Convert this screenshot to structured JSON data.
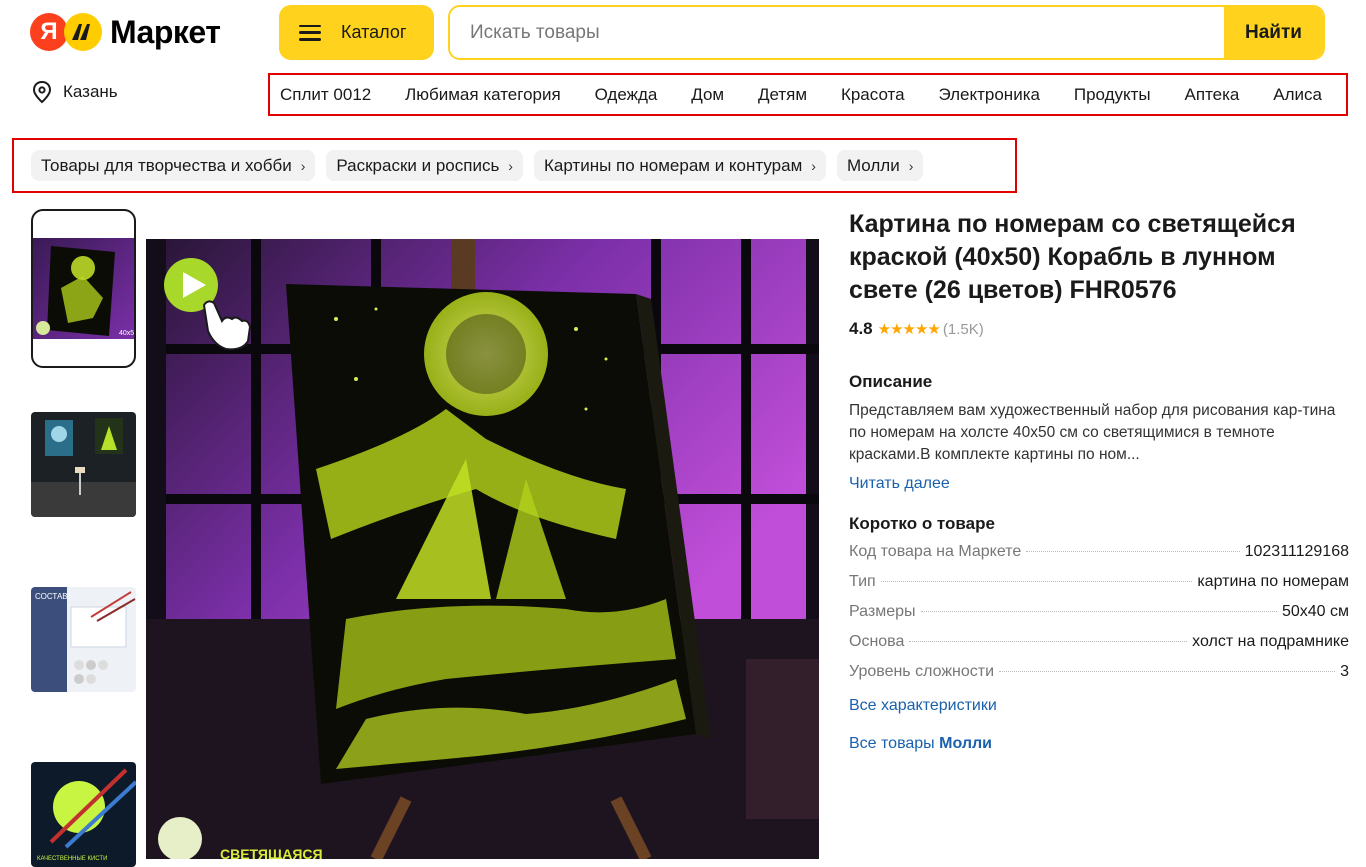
{
  "header": {
    "logo_ya": "Я",
    "logo_text": "Маркет",
    "catalog_label": "Каталог",
    "search_placeholder": "Искать товары",
    "search_button": "Найти"
  },
  "location": {
    "city": "Казань"
  },
  "nav": {
    "items": [
      {
        "label": "Сплит 0012"
      },
      {
        "label": "Любимая категория"
      },
      {
        "label": "Одежда"
      },
      {
        "label": "Дом"
      },
      {
        "label": "Детям"
      },
      {
        "label": "Красота"
      },
      {
        "label": "Электроника"
      },
      {
        "label": "Продукты"
      },
      {
        "label": "Аптека"
      },
      {
        "label": "Алиса"
      }
    ]
  },
  "breadcrumbs": [
    {
      "label": "Товары для творчества и хобби"
    },
    {
      "label": "Раскраски и роспись"
    },
    {
      "label": "Картины по номерам и контурам"
    },
    {
      "label": "Молли"
    }
  ],
  "gallery": {
    "thumb_size_label": "40x50",
    "main_caption": "СВЕТЯЩАЯСЯ",
    "thumb3_title": "СОСТАВ",
    "thumb4_caption": "КАЧЕСТВЕННЫЕ КИСТИ"
  },
  "product": {
    "title": "Картина по номерам со светящейся краской (40х50) Корабль в лунном свете (26 цветов) FHR0576",
    "rating": "4.8",
    "stars": "★★★★★",
    "rating_count": "(1.5K)",
    "description_title": "Описание",
    "description": "Представляем вам художественный набор для рисования кар-тина по номерам на холсте 40х50 см со светящимися в темноте красками.В комплекте картины по ном...",
    "read_more": "Читать далее",
    "specs_title": "Коротко о товаре",
    "specs": [
      {
        "label": "Код товара на Маркете",
        "value": "102311129168",
        "is_link": false
      },
      {
        "label": "Тип",
        "value": "картина по номерам",
        "is_link": true
      },
      {
        "label": "Размеры",
        "value": "50x40 см",
        "is_link": false
      },
      {
        "label": "Основа",
        "value": "холст на подрамнике",
        "is_link": true
      },
      {
        "label": "Уровень сложности",
        "value": "3",
        "is_link": true
      }
    ],
    "all_specs": "Все характеристики",
    "all_goods_prefix": "Все товары ",
    "all_goods_brand": "Молли"
  },
  "colors": {
    "accent_yellow": "#ffd21e",
    "link_blue": "#1961ac",
    "highlight_red": "#e00000",
    "logo_red": "#fc3f1d"
  }
}
